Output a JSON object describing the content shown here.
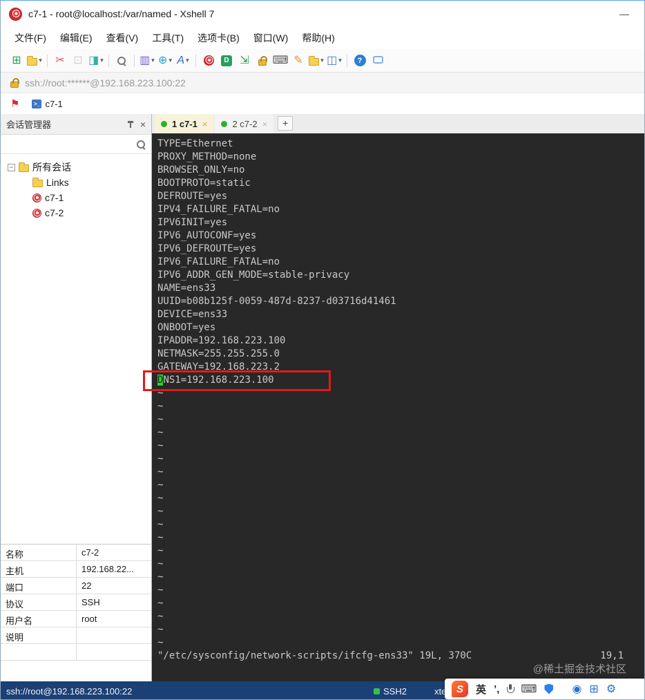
{
  "window": {
    "title": "c7-1 - root@localhost:/var/named - Xshell 7",
    "minimize_label": "—"
  },
  "menu_bar": {
    "items": [
      "文件(F)",
      "编辑(E)",
      "查看(V)",
      "工具(T)",
      "选项卡(B)",
      "窗口(W)",
      "帮助(H)"
    ]
  },
  "toolbar": {
    "icons": [
      {
        "name": "new-session-icon",
        "kind": "glyph",
        "glyph": "⊞",
        "color": "#28a25c"
      },
      {
        "name": "open-session-icon",
        "kind": "folder",
        "dropdown": true
      },
      {
        "name": "toolbar-divider-1",
        "kind": "divider"
      },
      {
        "name": "disconnect-icon",
        "kind": "glyph",
        "glyph": "✂",
        "color": "#e0556a"
      },
      {
        "name": "paste-icon",
        "kind": "glyph",
        "glyph": "⊡",
        "color": "#9a9a9a",
        "disabled": true
      },
      {
        "name": "session-properties-icon",
        "kind": "glyph",
        "glyph": "◨",
        "color": "#35b0a6",
        "dropdown": true
      },
      {
        "name": "toolbar-divider-2",
        "kind": "divider"
      },
      {
        "name": "find-icon",
        "kind": "mag"
      },
      {
        "name": "toolbar-divider-3",
        "kind": "divider"
      },
      {
        "name": "send-text-icon",
        "kind": "glyph",
        "glyph": "▥",
        "color": "#7a5ad6",
        "dropdown": true
      },
      {
        "name": "encoding-globe-icon",
        "kind": "glyph",
        "glyph": "⊕",
        "color": "#2e9ed0",
        "dropdown": true
      },
      {
        "name": "font-icon",
        "kind": "glyph",
        "glyph": "A",
        "color": "#3668c9",
        "italic": true,
        "dropdown": true
      },
      {
        "name": "toolbar-divider-4",
        "kind": "divider"
      },
      {
        "name": "xshell-logo-icon",
        "kind": "snail"
      },
      {
        "name": "xftp-icon",
        "kind": "xftp",
        "label": "D"
      },
      {
        "name": "fullscreen-icon",
        "kind": "glyph",
        "glyph": "⇲",
        "color": "#27a04a"
      },
      {
        "name": "lock-icon",
        "kind": "lock"
      },
      {
        "name": "keyboard-icon",
        "kind": "glyph",
        "glyph": "⌨",
        "color": "#5a5a5a"
      },
      {
        "name": "highlight-pen-icon",
        "kind": "glyph",
        "glyph": "✎",
        "color": "#e0922e"
      },
      {
        "name": "transfer-folder-icon",
        "kind": "folder",
        "dropdown": true
      },
      {
        "name": "layout-icon",
        "kind": "glyph",
        "glyph": "◫",
        "color": "#4a79c9",
        "dropdown": true
      },
      {
        "name": "toolbar-divider-5",
        "kind": "divider"
      },
      {
        "name": "help-icon",
        "kind": "help",
        "label": "?"
      },
      {
        "name": "feedback-icon",
        "kind": "bubble"
      }
    ]
  },
  "address_bar": {
    "url": "ssh://root:******@192.168.223.100:22"
  },
  "quick_bar": {
    "flag_glyph": "⚑",
    "session_label": "c7-1"
  },
  "session_manager": {
    "title": "会话管理器",
    "tree": {
      "root_label": "所有会话",
      "items": [
        {
          "label": "Links",
          "type": "folder"
        },
        {
          "label": "c7-1",
          "type": "session"
        },
        {
          "label": "c7-2",
          "type": "session"
        }
      ]
    },
    "properties": [
      {
        "key": "名称",
        "value": "c7-2"
      },
      {
        "key": "主机",
        "value": "192.168.22..."
      },
      {
        "key": "端口",
        "value": "22"
      },
      {
        "key": "协议",
        "value": "SSH"
      },
      {
        "key": "用户名",
        "value": "root"
      },
      {
        "key": "说明",
        "value": ""
      }
    ]
  },
  "tabs": {
    "items": [
      {
        "label": "1 c7-1",
        "active": true
      },
      {
        "label": "2 c7-2",
        "active": false
      }
    ],
    "new_tab_label": "+"
  },
  "terminal": {
    "config_lines": [
      "TYPE=Ethernet",
      "PROXY_METHOD=none",
      "BROWSER_ONLY=no",
      "BOOTPROTO=static",
      "DEFROUTE=yes",
      "IPV4_FAILURE_FATAL=no",
      "IPV6INIT=yes",
      "IPV6_AUTOCONF=yes",
      "IPV6_DEFROUTE=yes",
      "IPV6_FAILURE_FATAL=no",
      "IPV6_ADDR_GEN_MODE=stable-privacy",
      "NAME=ens33",
      "UUID=b08b125f-0059-487d-8237-d03716d41461",
      "DEVICE=ens33",
      "ONBOOT=yes",
      "IPADDR=192.168.223.100",
      "NETMASK=255.255.255.0",
      "GATEWAY=192.168.223.2",
      "DNS1=192.168.223.100"
    ],
    "highlight_line_index": 18,
    "cursor_char_index": 0,
    "tilde_char": "~",
    "tilde_count": 20,
    "vi_status": "\"/etc/sysconfig/network-scripts/ifcfg-ens33\" 19L, 370C",
    "cursor_position": "19,1"
  },
  "status_bar": {
    "session_url": "ssh://root@192.168.223.100:22",
    "protocol": "SSH2",
    "terminal_type": "xterm"
  },
  "ime_bar": {
    "items": [
      {
        "name": "sogou-logo-icon",
        "kind": "logo",
        "label": "S"
      },
      {
        "name": "ime-language-toggle",
        "kind": "text",
        "label": "英"
      },
      {
        "name": "ime-punctuation-toggle",
        "kind": "text",
        "label": "’,"
      },
      {
        "name": "microphone-icon",
        "kind": "mic"
      },
      {
        "name": "virtual-keyboard-icon",
        "kind": "glyph",
        "glyph": "⌨"
      },
      {
        "name": "input-shield-icon",
        "kind": "shield"
      },
      {
        "name": "tray-separator",
        "kind": "gap"
      },
      {
        "name": "tray-circle-icon",
        "kind": "tray",
        "glyph": "◉"
      },
      {
        "name": "tray-grid-icon",
        "kind": "tray",
        "glyph": "⊞"
      },
      {
        "name": "tray-gear-icon",
        "kind": "tray",
        "glyph": "⚙"
      }
    ]
  },
  "watermark": "@稀土掘金技术社区",
  "colors": {
    "highlight_box": "#e01b1b",
    "cursor_green": "#2fd12f",
    "status_bar_blue": "#1a4076",
    "terminal_bg": "#282828",
    "active_tab_bg": "#f6f3da"
  }
}
